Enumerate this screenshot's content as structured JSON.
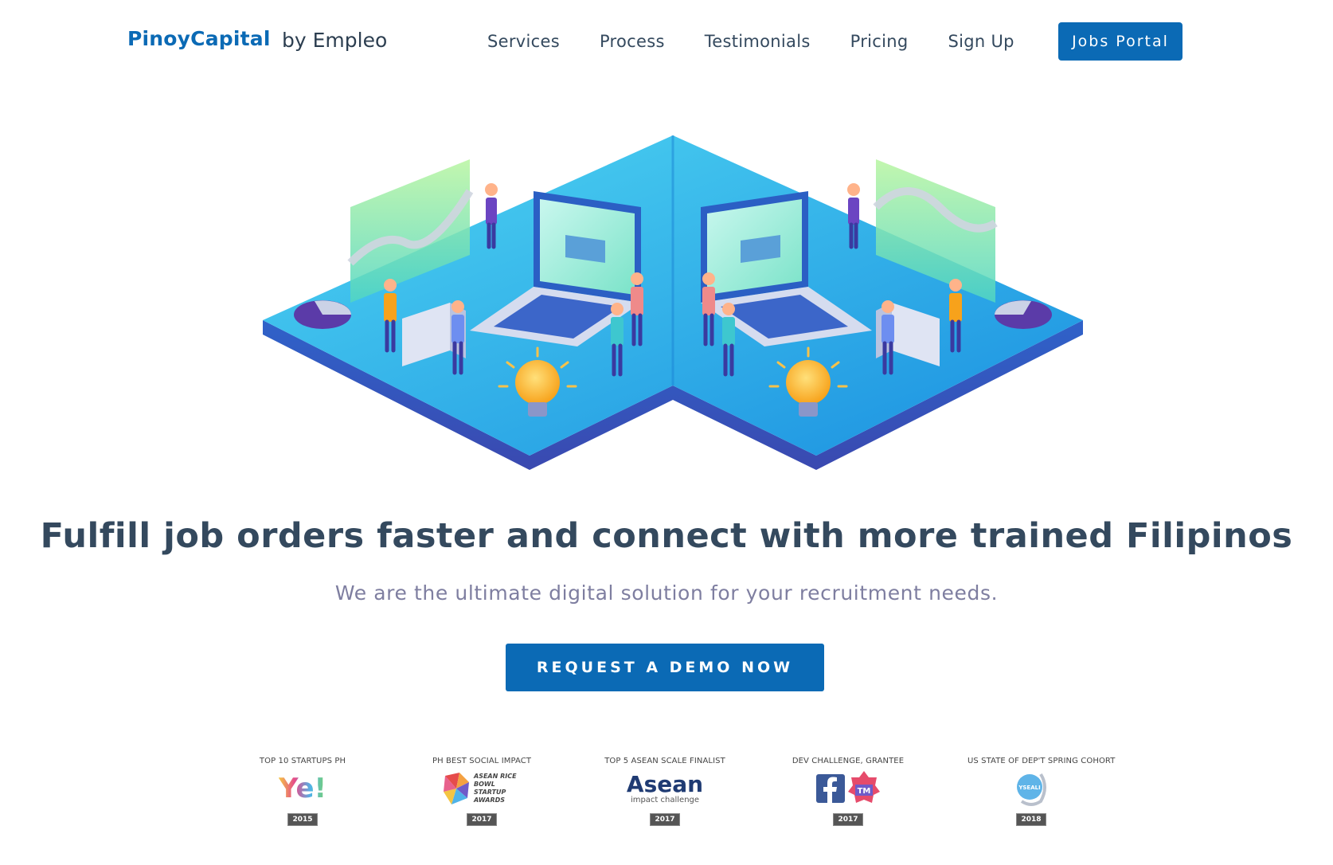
{
  "header": {
    "brand": "PinoyCapital",
    "brand_suffix": "by Empleo",
    "nav": [
      "Services",
      "Process",
      "Testimonials",
      "Pricing",
      "Sign Up"
    ],
    "cta": "Jobs Portal"
  },
  "hero": {
    "headline": "Fulfill job orders faster and connect with more trained Filipinos",
    "subheadline": "We are the ultimate digital solution for your recruitment needs.",
    "cta": "REQUEST A DEMO NOW"
  },
  "awards": [
    {
      "caption": "TOP 10 STARTUPS PH",
      "logo": "Ye!",
      "year": "2015"
    },
    {
      "caption": "PH BEST SOCIAL IMPACT",
      "logo": "ASEAN RICE BOWL STARTUP AWARDS",
      "year": "2017"
    },
    {
      "caption": "TOP 5 ASEAN SCALE FINALIST",
      "logo": "Asean",
      "logo_sub": "impact challenge",
      "year": "2017"
    },
    {
      "caption": "DEV CHALLENGE, GRANTEE",
      "logo": "facebook-icon",
      "year": "2017"
    },
    {
      "caption": "US STATE OF DEP'T SPRING COHORT",
      "logo": "YSEALI",
      "year": "2018"
    }
  ],
  "colors": {
    "primary": "#0b6ab5",
    "heading": "#34495e",
    "sub": "#7e7ea0",
    "platform": "#1ea6e6"
  }
}
